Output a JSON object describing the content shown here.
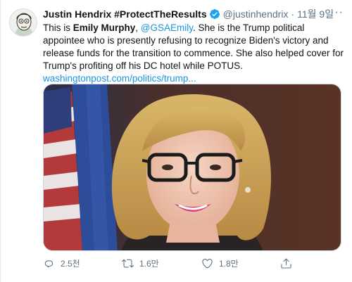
{
  "tweet": {
    "author_name": "Justin Hendrix #ProtectTheResults",
    "handle": "@justinhendrix",
    "separator": "·",
    "date": "11월 9일",
    "more_icon": "more-icon",
    "text": {
      "part1": "This is ",
      "bold_name": "Emily Murphy",
      "comma": ", ",
      "mention": "@GSAEmily",
      "part2": ". She is the Trump political appointee who is presently refusing to recognize Biden's victory and release funds for the transition to commence. She also helped cover for Trump's profiting off his DC hotel while POTUS."
    },
    "link": "washingtonpost.com/politics/trump...",
    "media_description_icon": "photo-portrait"
  },
  "actions": {
    "reply_count": "2.5천",
    "retweet_count": "1.6만",
    "like_count": "1.8만"
  },
  "colors": {
    "link": "#1b95e0",
    "verified": "#1da1f2",
    "muted": "#5b7083"
  }
}
